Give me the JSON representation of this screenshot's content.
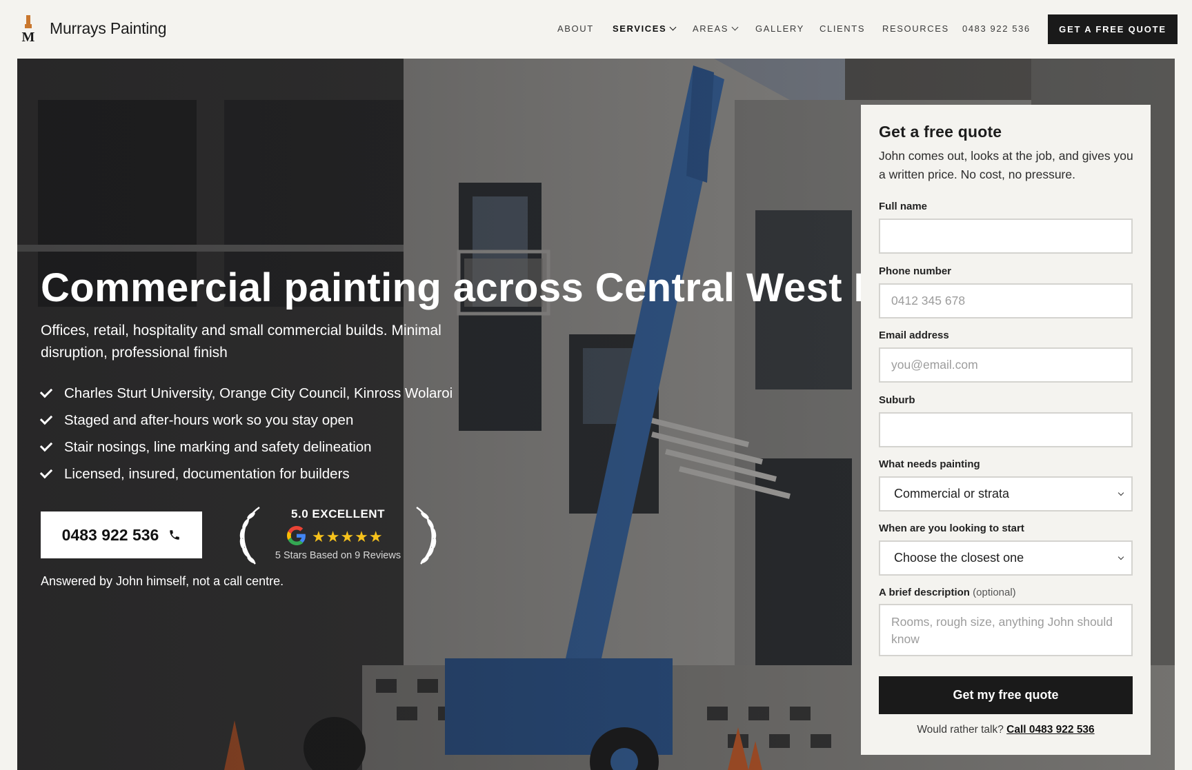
{
  "header": {
    "brand": "Murrays Painting",
    "nav": [
      {
        "label": "About"
      },
      {
        "label": "Services"
      },
      {
        "label": "Areas"
      },
      {
        "label": "Gallery"
      },
      {
        "label": "Clients"
      },
      {
        "label": "Resources"
      },
      {
        "label": "0483 922 536"
      }
    ],
    "cta_label": "GET A FREE QUOTE"
  },
  "hero": {
    "title": "Commercial painting across Central West NSW",
    "subtitle": "Offices, retail, hospitality and small commercial builds. Minimal disruption, professional finish",
    "checks": [
      "Charles Sturt University, Orange City Council, Kinross Wolaroi",
      "Staged and after-hours work so you stay open",
      "Stair nosings, line marking and safety delineation",
      "Licensed, insured, documentation for builders"
    ],
    "phone_button": "0483 922 536",
    "answered_note": "Answered by John himself, not a call centre.",
    "rating": {
      "headline": "5.0 EXCELLENT",
      "stars": "★★★★★",
      "stars_value": 5,
      "based_on": "5 Stars Based on 9 Reviews"
    }
  },
  "quote_form": {
    "title": "Get a free quote",
    "intro": "John comes out, looks at the job, and gives you a written price. No cost, no pressure.",
    "fields": {
      "full_name": {
        "label": "Full name",
        "value": "",
        "placeholder": ""
      },
      "phone": {
        "label": "Phone number",
        "value": "",
        "placeholder": "0412 345 678"
      },
      "email": {
        "label": "Email address",
        "value": "",
        "placeholder": "you@email.com"
      },
      "suburb": {
        "label": "Suburb",
        "value": "",
        "placeholder": ""
      },
      "what_painting": {
        "label": "What needs painting",
        "selected": "Commercial or strata"
      },
      "when_start": {
        "label": "When are you looking to start",
        "selected": "Choose the closest one"
      },
      "description": {
        "label": "A brief description",
        "optional": "(optional)",
        "placeholder": "Rooms, rough size, anything John should know"
      }
    },
    "submit_label": "Get my free quote",
    "talk_prefix": "Would rather talk?",
    "talk_link": "Call 0483 922 536"
  }
}
